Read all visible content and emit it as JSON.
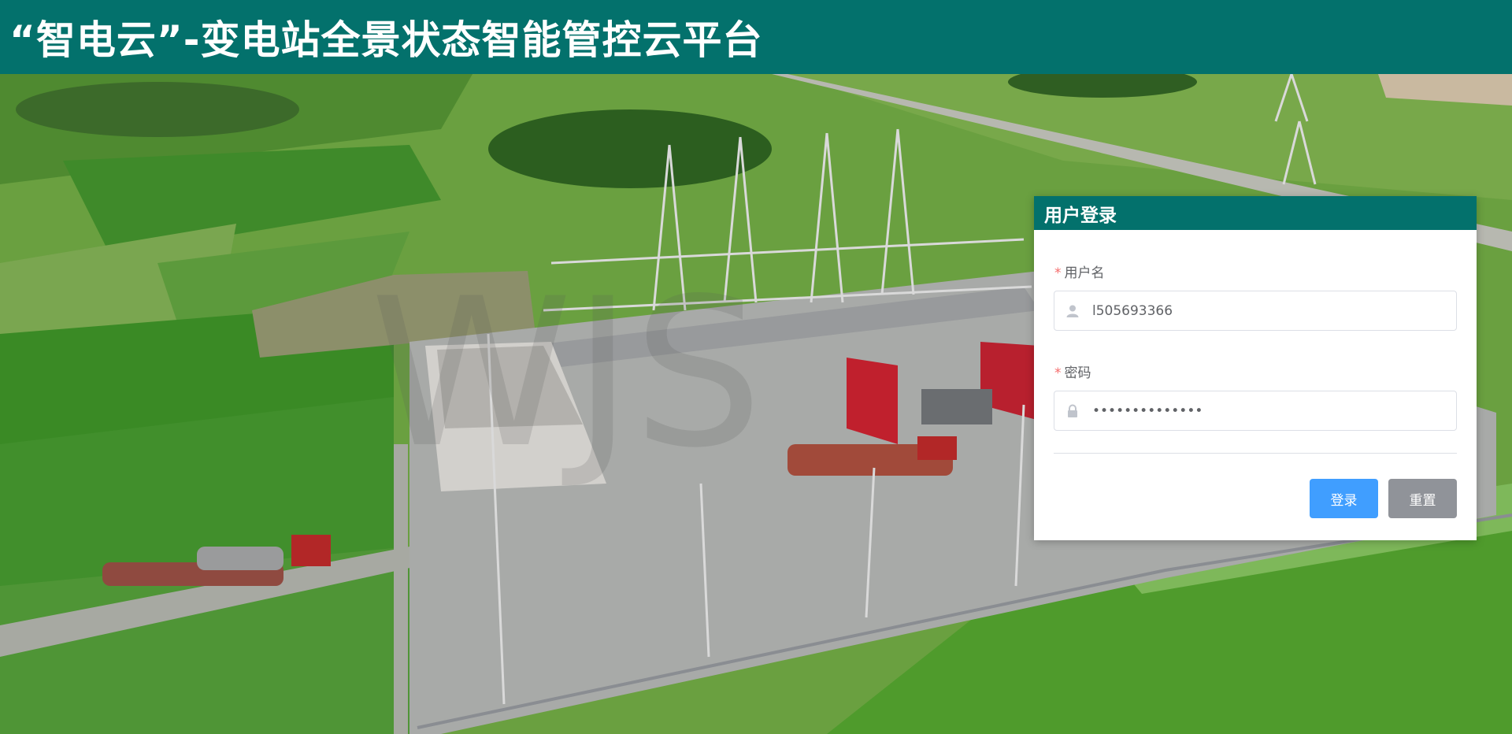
{
  "header": {
    "title": "“智电云”-变电站全景状态智能管控云平台"
  },
  "login": {
    "title": "用户登录",
    "username": {
      "label": "用户名",
      "required_mark": "*",
      "value": "l505693366"
    },
    "password": {
      "label": "密码",
      "required_mark": "*",
      "value": "••••••••••••••"
    },
    "buttons": {
      "login": "登录",
      "reset": "重置"
    }
  },
  "background": {
    "watermark": "WJS"
  },
  "icons": {
    "user": "user-icon",
    "lock": "lock-icon"
  },
  "colors": {
    "header": "#03716c",
    "primary": "#409eff",
    "secondary": "#909399",
    "required": "#f56c6c"
  }
}
